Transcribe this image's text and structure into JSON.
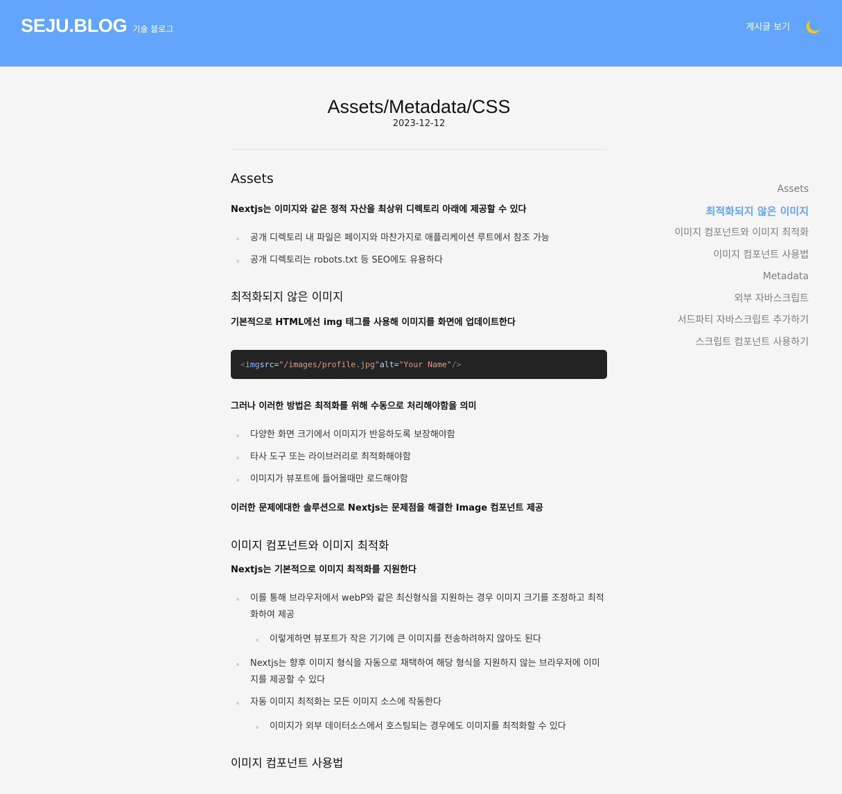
{
  "header": {
    "brand": "SEJU.BLOG",
    "brand_sub": "기술 블로그",
    "nav_posts": "게시글 보기",
    "accent": "#63a5fc",
    "moon_color": "#f9c814"
  },
  "post": {
    "title": "Assets/Metadata/CSS",
    "date": "2023-12-12",
    "sections": {
      "assets": {
        "heading": "Assets",
        "intro": "Nextjs는 이미지와 같은 정적 자산을 최상위 디렉토리 아래에 제공할 수 있다",
        "items": [
          "공개 디렉토리 내 파일은 페이지와 마찬가지로 애플리케이션 루트에서 참조 가능",
          "공개 디렉토리는 robots.txt 등 SEO에도 유용하다"
        ]
      },
      "unoptimized": {
        "heading": "최적화되지 않은 이미지",
        "intro": "기본적으로 HTML에선 img 태그를 사용해 이미지를 화면에 업데이트한다",
        "code": {
          "open": "<",
          "tag": "img",
          "attr1": "src",
          "val1": "\"/images/profile.jpg\"",
          "attr2": "alt",
          "val2": "\"Your Name\"",
          "close": "/>"
        },
        "para2": "그러나 이러한 방법은 최적화를 위해 수동으로 처리해야함을 의미",
        "items": [
          "다양한 화면 크기에서 이미지가 반응하도록 보장해야함",
          "타사 도구 또는 라이브러리로 최적화해야함",
          "이미지가 뷰포트에 들어올때만 로드해야함"
        ],
        "para3": "이러한 문제에대한 솔루션으로 Nextjs는 문제점을 해결한 Image 컴포넌트 제공"
      },
      "image_component": {
        "heading": "이미지 컴포넌트와 이미지 최적화",
        "intro": "Nextjs는 기본적으로 이미지 최적화를 지원한다",
        "item1": "이를 통해 브라우저에서 webP와 같은 최신형식을 지원하는 경우 이미지 크기를 조정하고 최적화하여 제공",
        "item1_nested": "이렇게하면 뷰포트가 작은 기기에 큰 이미지를 전송하려하지 않아도 된다",
        "item2": "Nextjs는 향후 이미지 형식을 자동으로 채택하여 해당 형식을 지원하지 않는 브라우저에 이미지를 제공할 수 있다",
        "item3": "자동 이미지 최적화는 모든 이미지 소스에 작동한다",
        "item3_nested": "이미지가 외부 데이터소스에서 호스팅되는 경우에도 이미지를 최적화할 수 있다"
      },
      "usage": {
        "heading": "이미지 컴포넌트 사용법"
      }
    }
  },
  "toc": {
    "items": [
      "Assets",
      "최적화되지 않은 이미지",
      "이미지 컴포넌트와 이미지 최적화",
      "이미지 컴포넌트 사용법",
      "Metadata",
      "외부 자바스크립트",
      "서드파티 자바스크립트 추가하기",
      "스크립트 컴포넌트 사용하기"
    ],
    "active_index": 1
  }
}
